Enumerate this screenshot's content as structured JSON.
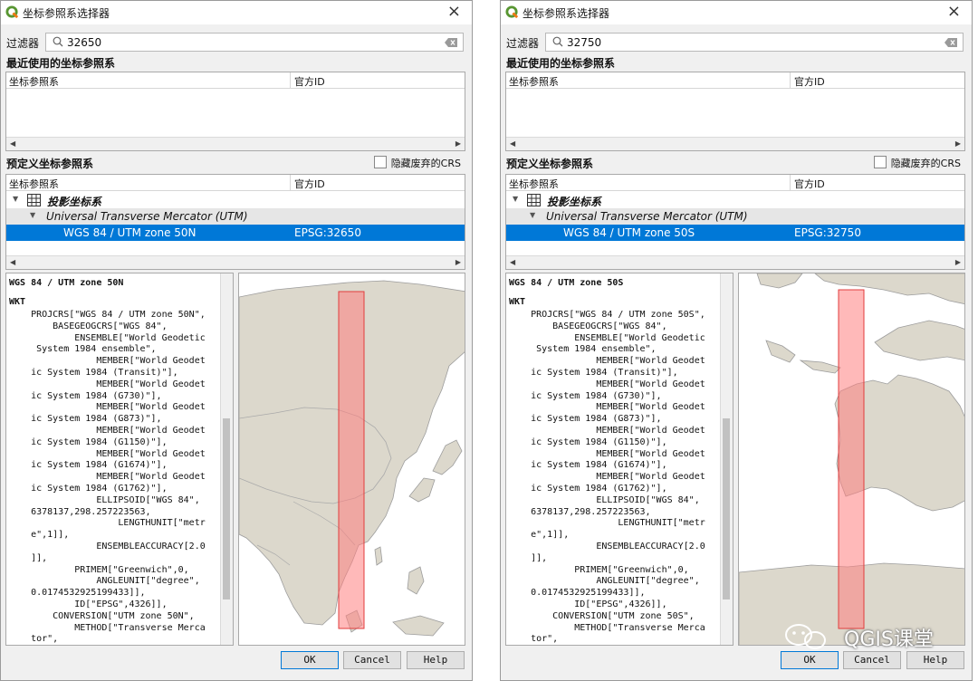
{
  "dialogs": [
    {
      "title": "坐标参照系选择器",
      "filter_label": "过滤器",
      "filter_value": "32650",
      "recent_title": "最近使用的坐标参照系",
      "col_crs": "坐标参照系",
      "col_authid": "官方ID",
      "predefined_title": "预定义坐标参照系",
      "hide_deprecated": "隐藏废弃的CRS",
      "tree_projected": "投影坐标系",
      "tree_utm": "Universal Transverse Mercator (UTM)",
      "selected_name": "WGS 84 / UTM zone 50N",
      "selected_id": "EPSG:32650",
      "wkt_title": "WGS 84 / UTM zone 50N",
      "wkt_label": "WKT",
      "wkt_text": "    PROJCRS[\"WGS 84 / UTM zone 50N\",\n        BASEGEOGCRS[\"WGS 84\",\n            ENSEMBLE[\"World Geodetic\n     System 1984 ensemble\",\n                MEMBER[\"World Geodet\n    ic System 1984 (Transit)\"],\n                MEMBER[\"World Geodet\n    ic System 1984 (G730)\"],\n                MEMBER[\"World Geodet\n    ic System 1984 (G873)\"],\n                MEMBER[\"World Geodet\n    ic System 1984 (G1150)\"],\n                MEMBER[\"World Geodet\n    ic System 1984 (G1674)\"],\n                MEMBER[\"World Geodet\n    ic System 1984 (G1762)\"],\n                ELLIPSOID[\"WGS 84\",\n    6378137,298.257223563,\n                    LENGTHUNIT[\"metr\n    e\",1]],\n                ENSEMBLEACCURACY[2.0\n    ]],\n            PRIMEM[\"Greenwich\",0,\n                ANGLEUNIT[\"degree\",\n    0.0174532925199433]],\n            ID[\"EPSG\",4326]],\n        CONVERSION[\"UTM zone 50N\",\n            METHOD[\"Transverse Merca\n    tor\",",
      "ok": "OK",
      "cancel": "Cancel",
      "help": "Help"
    },
    {
      "title": "坐标参照系选择器",
      "filter_label": "过滤器",
      "filter_value": "32750",
      "recent_title": "最近使用的坐标参照系",
      "col_crs": "坐标参照系",
      "col_authid": "官方ID",
      "predefined_title": "预定义坐标参照系",
      "hide_deprecated": "隐藏废弃的CRS",
      "tree_projected": "投影坐标系",
      "tree_utm": "Universal Transverse Mercator (UTM)",
      "selected_name": "WGS 84 / UTM zone 50S",
      "selected_id": "EPSG:32750",
      "wkt_title": "WGS 84 / UTM zone 50S",
      "wkt_label": "WKT",
      "wkt_text": "    PROJCRS[\"WGS 84 / UTM zone 50S\",\n        BASEGEOGCRS[\"WGS 84\",\n            ENSEMBLE[\"World Geodetic\n     System 1984 ensemble\",\n                MEMBER[\"World Geodet\n    ic System 1984 (Transit)\"],\n                MEMBER[\"World Geodet\n    ic System 1984 (G730)\"],\n                MEMBER[\"World Geodet\n    ic System 1984 (G873)\"],\n                MEMBER[\"World Geodet\n    ic System 1984 (G1150)\"],\n                MEMBER[\"World Geodet\n    ic System 1984 (G1674)\"],\n                MEMBER[\"World Geodet\n    ic System 1984 (G1762)\"],\n                ELLIPSOID[\"WGS 84\",\n    6378137,298.257223563,\n                    LENGTHUNIT[\"metr\n    e\",1]],\n                ENSEMBLEACCURACY[2.0\n    ]],\n            PRIMEM[\"Greenwich\",0,\n                ANGLEUNIT[\"degree\",\n    0.0174532925199433]],\n            ID[\"EPSG\",4326]],\n        CONVERSION[\"UTM zone 50S\",\n            METHOD[\"Transverse Merca\n    tor\",",
      "ok": "OK",
      "cancel": "Cancel",
      "help": "Help"
    }
  ],
  "watermark": {
    "text": "QGIS课堂"
  },
  "colors": {
    "selection": "#0078d7",
    "land": "#dcd8cc",
    "zone_fill": "#ff8080",
    "zone_stroke": "#e03c3c"
  },
  "icons": [
    "qgis-logo-icon",
    "close-icon",
    "search-icon",
    "clear-icon",
    "expand-arrow-icon",
    "grid-icon",
    "scroll-left-icon",
    "scroll-right-icon",
    "wechat-icon"
  ]
}
